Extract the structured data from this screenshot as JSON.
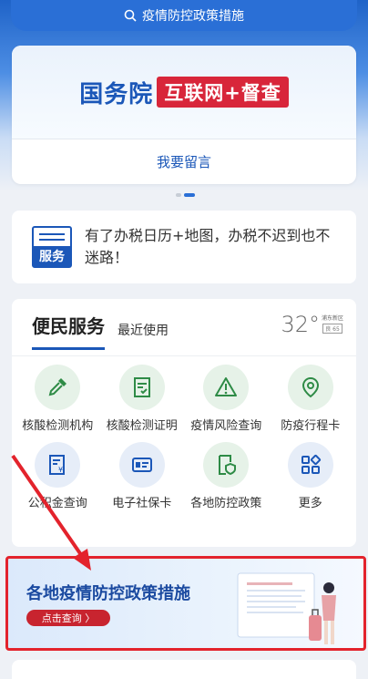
{
  "search": {
    "label": "疫情防控政策措施"
  },
  "banner": {
    "org_name": "国务院",
    "tag": "互联网+督查",
    "link_label": "我要留言"
  },
  "notice": {
    "icon_label": "服务",
    "text": "有了办税日历+地图，办税不迟到也不迷路！"
  },
  "services": {
    "tab_main": "便民服务",
    "tab_recent": "最近使用",
    "weather": {
      "temp": "32°",
      "district": "浦东新区",
      "aqi": "良 65"
    },
    "items": [
      {
        "label": "核酸检测机构",
        "icon": "dropper-icon"
      },
      {
        "label": "核酸检测证明",
        "icon": "certificate-icon"
      },
      {
        "label": "疫情风险查询",
        "icon": "warning-icon"
      },
      {
        "label": "防疫行程卡",
        "icon": "location-pin-icon"
      },
      {
        "label": "公积金查询",
        "icon": "fund-doc-icon"
      },
      {
        "label": "电子社保卡",
        "icon": "id-card-icon"
      },
      {
        "label": "各地防控政策",
        "icon": "shield-doc-icon"
      },
      {
        "label": "更多",
        "icon": "grid-icon"
      }
    ]
  },
  "promo": {
    "title": "各地疫情防控政策措施",
    "button": "点击查询 〉"
  },
  "colors": {
    "primary": "#1b57b8",
    "accent_red": "#d8263a",
    "highlight_border": "#e3232c"
  }
}
